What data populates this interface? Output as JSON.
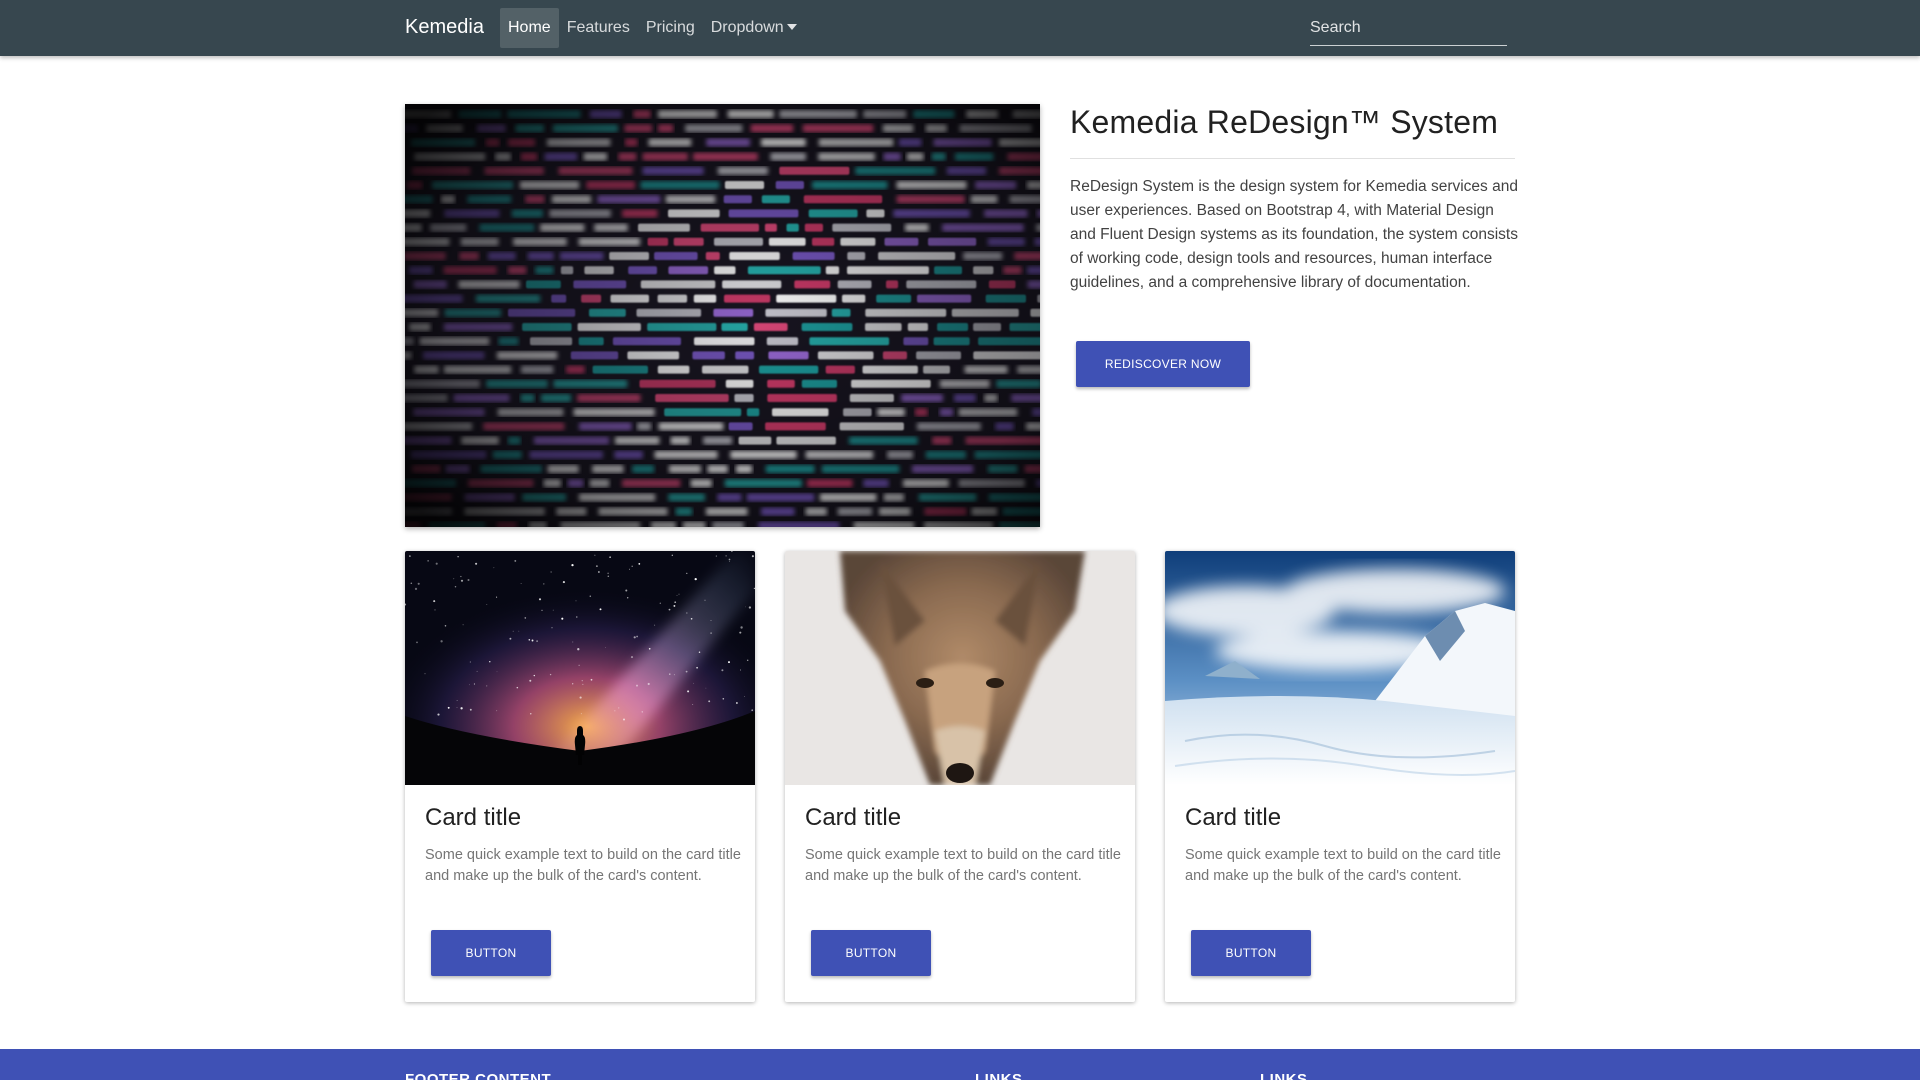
{
  "navbar": {
    "brand": "Kemedia",
    "links": [
      {
        "label": "Home",
        "active": true
      },
      {
        "label": "Features",
        "active": false
      },
      {
        "label": "Pricing",
        "active": false
      },
      {
        "label": "Dropdown",
        "active": false
      }
    ],
    "search_placeholder": "Search"
  },
  "hero": {
    "title": "Kemedia ReDesign™ System",
    "description": "ReDesign System is the design system for Kemedia services and user experiences. Based on Bootstrap 4, with Material Design and Fluent Design systems as its foundation, the system consists of working code, design tools and resources, human interface guidelines, and a comprehensive library of documentation.",
    "button_label": "Rediscover now"
  },
  "cards": [
    {
      "title": "Card title",
      "text": "Some quick example text to build on the card title and make up the bulk of the card's content.",
      "button_label": "Button"
    },
    {
      "title": "Card title",
      "text": "Some quick example text to build on the card title and make up the bulk of the card's content.",
      "button_label": "Button"
    },
    {
      "title": "Card title",
      "text": "Some quick example text to build on the card title and make up the bulk of the card's content.",
      "button_label": "Button"
    }
  ],
  "footer": {
    "headings": [
      "Footer Content",
      "Links",
      "Links"
    ]
  },
  "colors": {
    "navbar_bg": "#37474f",
    "primary": "#3f51b5",
    "footer_bg": "#3f51b5"
  }
}
